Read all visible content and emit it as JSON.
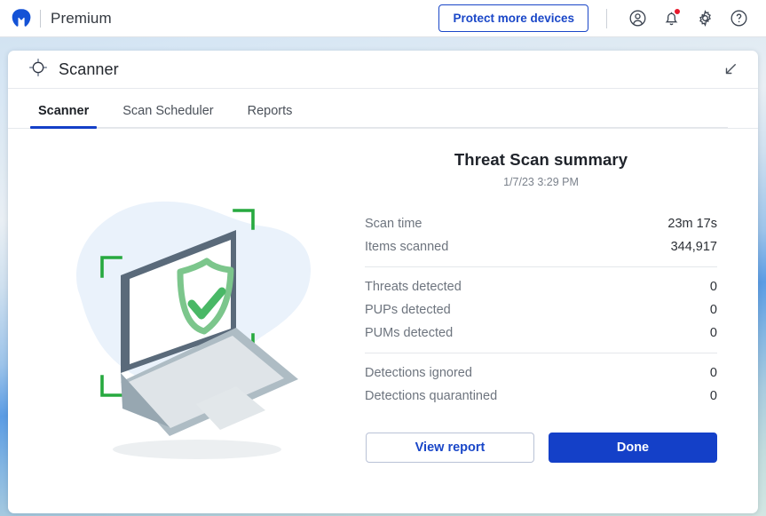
{
  "header": {
    "brand": "Premium",
    "logo_icon": "malwarebytes-m-logo",
    "protect_button": "Protect more devices",
    "icons": [
      {
        "name": "account-icon",
        "glyph": "account"
      },
      {
        "name": "notifications-bell-icon",
        "glyph": "bell",
        "badge": true
      },
      {
        "name": "settings-gear-icon",
        "glyph": "gear"
      },
      {
        "name": "help-icon",
        "glyph": "question"
      }
    ]
  },
  "card": {
    "title": "Scanner",
    "title_icon": "crosshair-target-icon",
    "collapse_icon": "collapse-arrow-icon",
    "tabs": [
      {
        "label": "Scanner",
        "active": true
      },
      {
        "label": "Scan Scheduler",
        "active": false
      },
      {
        "label": "Reports",
        "active": false
      }
    ]
  },
  "illustration": {
    "name": "laptop-shield-check-illustration",
    "blob_color": "#eaf2fb",
    "shield_color": "#7cc68c",
    "check_color": "#49b866",
    "bracket_color": "#27a93f",
    "laptop_screen_frame": "#5a6a7a",
    "laptop_base": "#aebcc4"
  },
  "summary": {
    "title": "Threat Scan summary",
    "date": "1/7/23 3:29 PM",
    "groups": [
      [
        {
          "label": "Scan time",
          "value": "23m 17s"
        },
        {
          "label": "Items scanned",
          "value": "344,917"
        }
      ],
      [
        {
          "label": "Threats detected",
          "value": "0"
        },
        {
          "label": "PUPs detected",
          "value": "0"
        },
        {
          "label": "PUMs detected",
          "value": "0"
        }
      ],
      [
        {
          "label": "Detections ignored",
          "value": "0"
        },
        {
          "label": "Detections quarantined",
          "value": "0"
        }
      ]
    ],
    "view_report_button": "View report",
    "done_button": "Done"
  },
  "colors": {
    "accent_blue": "#1440c8",
    "brand_blue": "#1a47c8",
    "badge_red": "#e8192c",
    "label_gray": "#6d747e"
  }
}
